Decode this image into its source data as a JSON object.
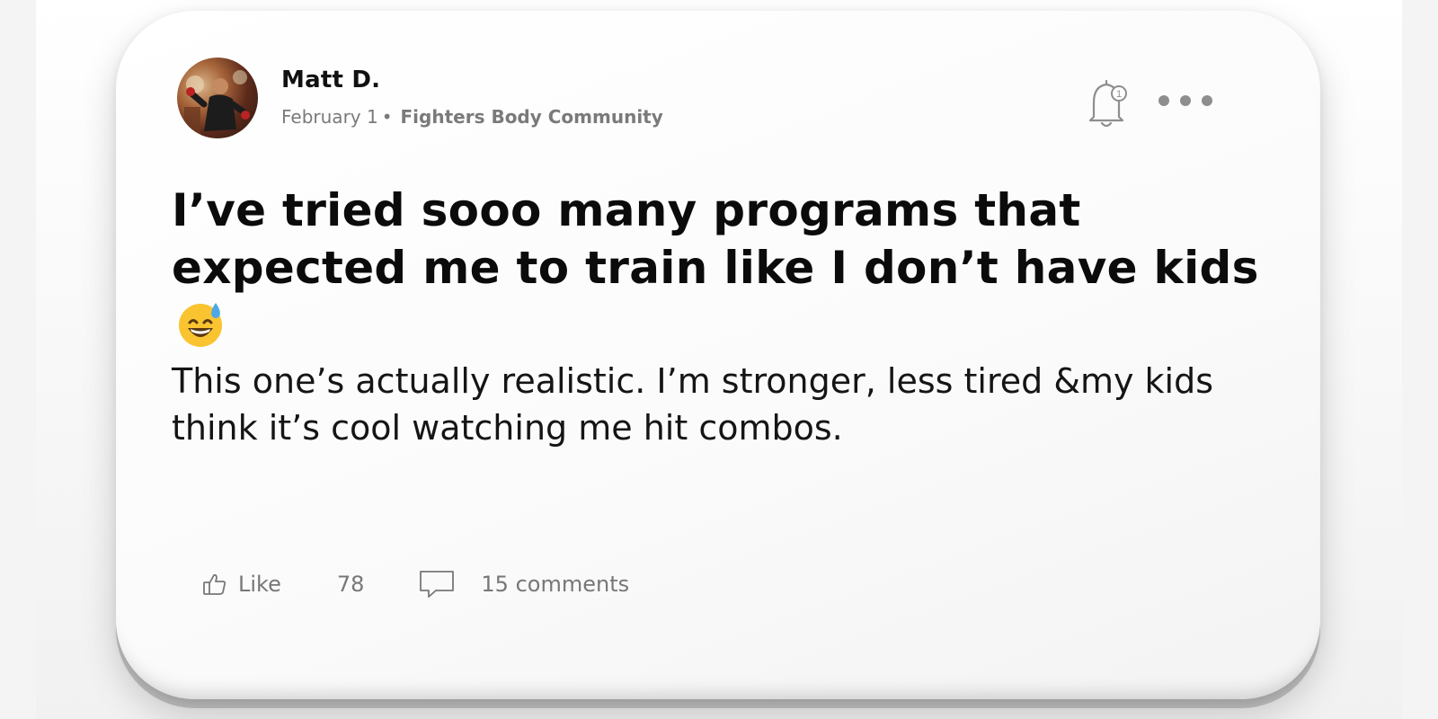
{
  "post": {
    "author": {
      "name": "Matt D.",
      "avatar_icon": "profile-photo"
    },
    "date": "February 1",
    "separator": "•",
    "community": "Fighters Body Community",
    "title": "I’ve tried sooo many programs that expected me to train like I don’t have kids",
    "title_emoji": "grinning-face-with-sweat-icon",
    "body": "This one’s actually realistic. I’m stronger, less tired &my kids think it’s cool watching me hit combos."
  },
  "header_actions": {
    "notification_icon": "bell-icon",
    "notification_badge": "1",
    "more_icon": "more-horizontal-icon"
  },
  "footer": {
    "like_label": "Like",
    "like_icon": "thumbs-up-icon",
    "like_count": "78",
    "comment_icon": "comment-bubble-icon",
    "comments_label": "15 comments"
  },
  "colors": {
    "title": "#0b0b0b",
    "meta": "#7a7a7a",
    "icon": "#8e8e8e",
    "emoji_face": "#f9c430",
    "sweat": "#4ea7e6"
  }
}
